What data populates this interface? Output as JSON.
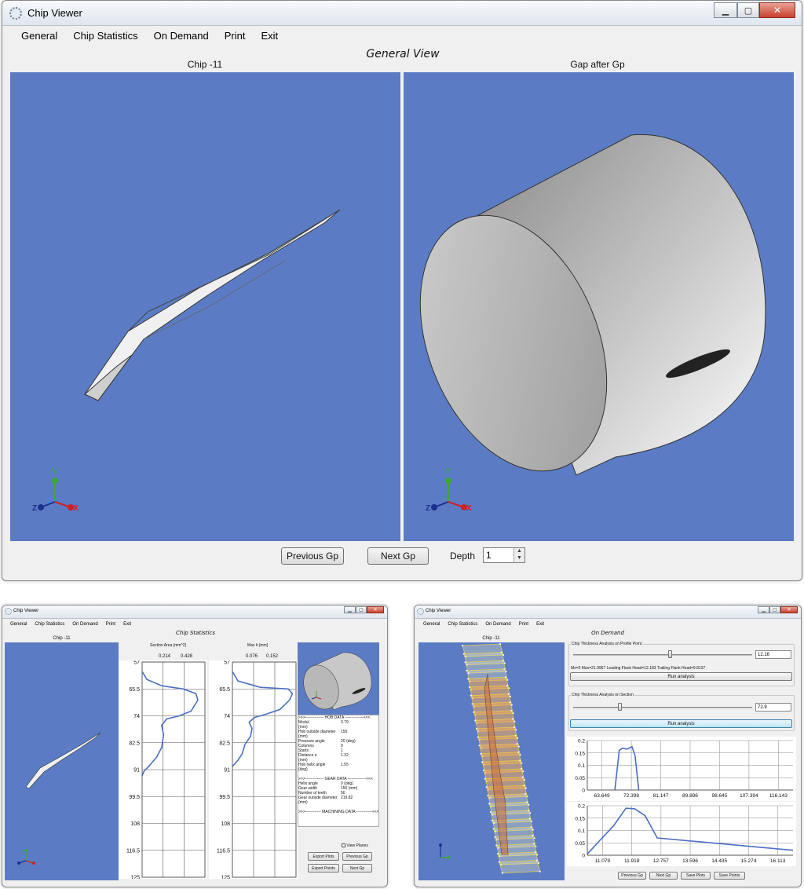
{
  "main": {
    "title": "Chip Viewer",
    "menu": [
      "General",
      "Chip Statistics",
      "On Demand",
      "Print",
      "Exit"
    ],
    "view_title": "General View",
    "left_pane_label": "Chip -11",
    "right_pane_label": "Gap after Gp",
    "prev_label": "Previous Gp",
    "next_label": "Next Gp",
    "depth_label": "Depth",
    "depth_value": "1",
    "axes": {
      "x": "X",
      "y": "Y",
      "z": "Z"
    }
  },
  "stats": {
    "title": "Chip Viewer",
    "menu": [
      "General",
      "Chip Statistics",
      "On Demand",
      "Print",
      "Exit"
    ],
    "view_title": "Chip Statistics",
    "pane_label": "Chip -11",
    "plot1_title": "Section Area [mm^2]",
    "plot1_ticks": [
      "0.214",
      "0.428"
    ],
    "plot2_title": "Max h [mm]",
    "plot2_ticks": [
      "0.076",
      "0.152"
    ],
    "y_ticks": [
      "57",
      "65.5",
      "74",
      "82.5",
      "91",
      "99.5",
      "108",
      "116.5",
      "125"
    ],
    "view_planes": "View Planes",
    "hob_header": ">>>-------------- HOB DATA --------------<<<",
    "hob_rows": [
      {
        "k": "Modul",
        "v": "3.79"
      },
      {
        "k": "(mm)",
        "v": ""
      },
      {
        "k": "Hob outside diameter",
        "v": "150"
      },
      {
        "k": "(mm)",
        "v": ""
      },
      {
        "k": "Pressure angle",
        "v": "20 (deg)"
      },
      {
        "k": "Columns",
        "v": "9"
      },
      {
        "k": "Starts",
        "v": "1"
      },
      {
        "k": "Distance e",
        "v": "1.32"
      },
      {
        "k": "(mm)",
        "v": ""
      },
      {
        "k": "Hob helix angle",
        "v": "1.55"
      },
      {
        "k": "(deg)",
        "v": ""
      }
    ],
    "gear_header": ">>>-------------- GEAR DATA --------------<<<",
    "gear_rows": [
      {
        "k": "Helix angle",
        "v": "0 (deg)"
      },
      {
        "k": "Gear width",
        "v": "150 (mm)"
      },
      {
        "k": "Number of teeth",
        "v": "56"
      },
      {
        "k": "Gear outside diameter",
        "v": "219.82"
      },
      {
        "k": "(mm)",
        "v": ""
      }
    ],
    "machining_header": ">>>------------ MACHINING DATA ------------<<<",
    "export_plots": "Export Plots",
    "previous_gp": "Previous Gp",
    "export_points": "Export Points",
    "next_gp": "Next Gp"
  },
  "ondemand": {
    "title": "Chip Viewer",
    "menu": [
      "General",
      "Chip Statistics",
      "On Demand",
      "Print",
      "Exit"
    ],
    "view_title": "On Demand",
    "pane_label": "Chip -11",
    "profile_group": "Chip Thickness Analysis on Profile Point",
    "profile_value": "12.16",
    "profile_result": "Mx=0 Max=21.9967 Leading Flank Head=12.183 Trailing Flank Head=9.8137",
    "run_label": "Run analysis",
    "section_group": "Chip Thickness Analysis on Section",
    "section_value": "72.9",
    "previous_gp": "Previous Gp",
    "next_gp": "Next Gp",
    "save_plots": "Save Plots",
    "save_points": "Save Points"
  },
  "chart_data": [
    {
      "type": "line",
      "title": "Section Area [mm^2]",
      "orientation": "vertical",
      "xlim": [
        0,
        0.642
      ],
      "x_ticks": [
        0.214,
        0.428
      ],
      "ylim": [
        57,
        125
      ],
      "y_ticks": [
        57,
        65.5,
        74,
        82.5,
        91,
        99.5,
        108,
        116.5,
        125
      ],
      "points": [
        [
          0.0,
          60
        ],
        [
          0.05,
          62.5
        ],
        [
          0.2,
          64.5
        ],
        [
          0.42,
          65.5
        ],
        [
          0.55,
          67
        ],
        [
          0.57,
          69
        ],
        [
          0.5,
          72.5
        ],
        [
          0.38,
          74
        ],
        [
          0.25,
          75
        ],
        [
          0.2,
          77
        ],
        [
          0.22,
          80
        ],
        [
          0.2,
          84
        ],
        [
          0.15,
          87
        ],
        [
          0.08,
          89.5
        ],
        [
          0.02,
          91.5
        ],
        [
          0.0,
          93
        ]
      ]
    },
    {
      "type": "line",
      "title": "Max h [mm]",
      "orientation": "vertical",
      "xlim": [
        0,
        0.228
      ],
      "x_ticks": [
        0.076,
        0.152
      ],
      "ylim": [
        57,
        125
      ],
      "y_ticks": [
        57,
        65.5,
        74,
        82.5,
        91,
        99.5,
        108,
        116.5,
        125
      ],
      "points": [
        [
          0.0,
          60
        ],
        [
          0.02,
          63
        ],
        [
          0.1,
          65
        ],
        [
          0.2,
          65.5
        ],
        [
          0.215,
          67
        ],
        [
          0.205,
          69
        ],
        [
          0.17,
          72
        ],
        [
          0.12,
          73.5
        ],
        [
          0.08,
          74.5
        ],
        [
          0.06,
          76
        ],
        [
          0.07,
          78
        ],
        [
          0.065,
          80.5
        ],
        [
          0.045,
          83
        ],
        [
          0.035,
          86
        ],
        [
          0.02,
          88
        ],
        [
          0.0,
          90
        ]
      ]
    },
    {
      "type": "line",
      "xlim": [
        59.3,
        120.5
      ],
      "ylim": [
        0,
        0.2
      ],
      "x_ticks": [
        63.649,
        72.398,
        81.147,
        89.896,
        98.645,
        107.394,
        116.143
      ],
      "y_ticks": [
        0,
        0.05,
        0.1,
        0.15,
        0.2
      ],
      "points": [
        [
          67.5,
          0
        ],
        [
          68.8,
          0.16
        ],
        [
          69.8,
          0.17
        ],
        [
          71.0,
          0.165
        ],
        [
          72.6,
          0.175
        ],
        [
          73.5,
          0.14
        ],
        [
          74.6,
          0
        ]
      ]
    },
    {
      "type": "line",
      "xlim": [
        10.64,
        16.55
      ],
      "ylim": [
        0,
        0.2
      ],
      "x_ticks": [
        11.079,
        11.918,
        12.757,
        13.596,
        14.435,
        15.274,
        16.113
      ],
      "y_ticks": [
        0,
        0.05,
        0.1,
        0.15,
        0.2
      ],
      "points": [
        [
          10.64,
          0.005
        ],
        [
          11.4,
          0.12
        ],
        [
          11.75,
          0.19
        ],
        [
          12.0,
          0.188
        ],
        [
          12.3,
          0.16
        ],
        [
          12.65,
          0.07
        ],
        [
          16.55,
          0.02
        ]
      ]
    }
  ],
  "colors": {
    "viewport": "#5b7cc4",
    "plot_line": "#4a6fc6",
    "axis_x": "#d02020",
    "axis_y": "#3ca83c",
    "axis_z": "#1b2f8f"
  }
}
